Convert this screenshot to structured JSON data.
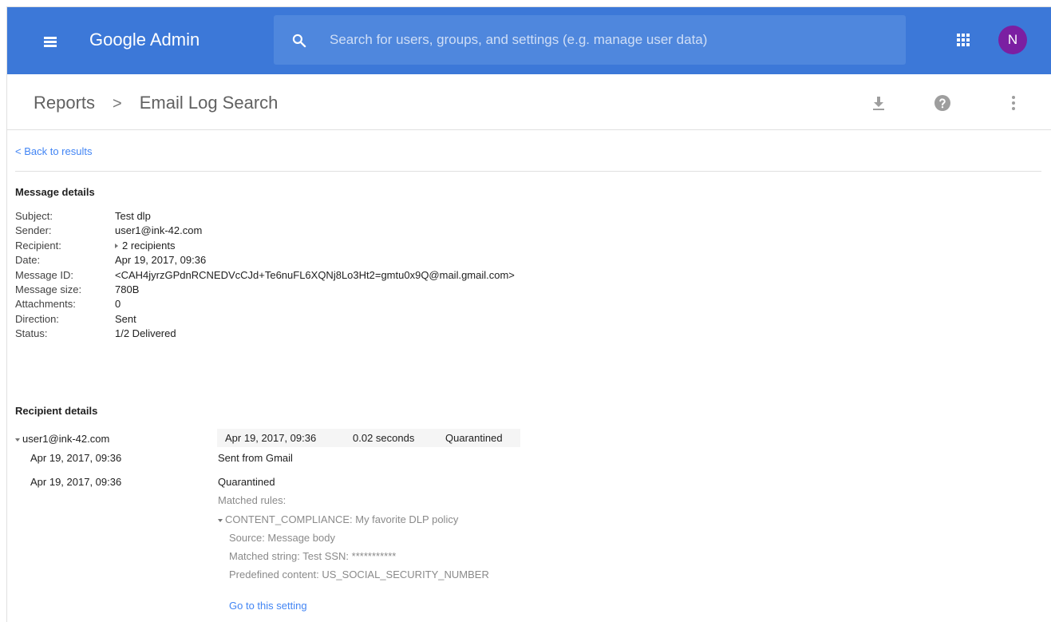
{
  "header": {
    "brand": "Google Admin",
    "search_placeholder": "Search for users, groups, and settings (e.g. manage user data)",
    "avatar_initial": "N",
    "colors": {
      "bar": "#3c78d8",
      "avatar": "#7b1fa2"
    }
  },
  "breadcrumb": {
    "root": "Reports",
    "separator": ">",
    "current": "Email Log Search"
  },
  "toolbar": {
    "icons": [
      "download-icon",
      "help-icon",
      "more-vert-icon"
    ]
  },
  "back_link": "< Back to results",
  "message_details": {
    "title": "Message details",
    "fields": [
      {
        "label": "Subject:",
        "value": "Test dlp"
      },
      {
        "label": "Sender:",
        "value": "user1@ink-42.com"
      },
      {
        "label": "Recipient:",
        "value": "2 recipients"
      },
      {
        "label": "Date:",
        "value": "Apr 19, 2017, 09:36"
      },
      {
        "label": "Message ID:",
        "value": "<CAH4jyrzGPdnRCNEDVcCJd+Te6nuFL6XQNj8Lo3Ht2=gmtu0x9Q@mail.gmail.com>"
      },
      {
        "label": "Message size:",
        "value": "780B"
      },
      {
        "label": "Attachments:",
        "value": "0"
      },
      {
        "label": "Direction:",
        "value": "Sent"
      },
      {
        "label": "Status:",
        "value": "1/2 Delivered"
      }
    ]
  },
  "recipient_details": {
    "title": "Recipient details",
    "recipient": "user1@ink-42.com",
    "summary": {
      "date": "Apr 19, 2017, 09:36",
      "duration": "0.02 seconds",
      "status": "Quarantined"
    },
    "events": [
      {
        "date": "Apr 19, 2017, 09:36",
        "description": "Sent from Gmail"
      },
      {
        "date": "Apr 19, 2017, 09:36",
        "description": "Quarantined"
      }
    ],
    "matched_rules_label": "Matched rules:",
    "rule": "CONTENT_COMPLIANCE: My favorite DLP policy",
    "rule_details": [
      "Source: Message body",
      "Matched string: Test SSN: ***********",
      "Predefined content: US_SOCIAL_SECURITY_NUMBER"
    ],
    "goto_link": "Go to this setting"
  }
}
